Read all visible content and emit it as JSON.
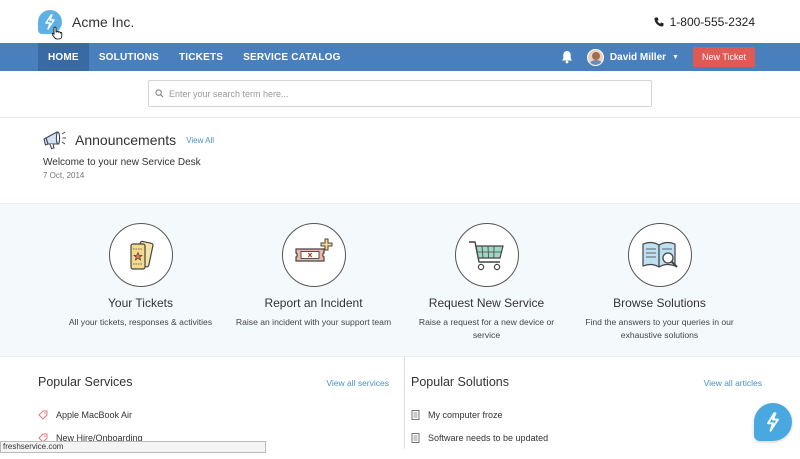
{
  "header": {
    "brand": "Acme Inc.",
    "phone": "1-800-555-2324"
  },
  "nav": {
    "items": [
      "HOME",
      "SOLUTIONS",
      "TICKETS",
      "SERVICE CATALOG"
    ],
    "user_name": "David Miller",
    "new_ticket": "New Ticket"
  },
  "search": {
    "placeholder": "Enter your search term here..."
  },
  "announcements": {
    "title": "Announcements",
    "view_all": "View All",
    "message": "Welcome to your new Service Desk",
    "date": "7 Oct, 2014"
  },
  "features": [
    {
      "title": "Your Tickets",
      "desc": "All your tickets, responses & activities",
      "icon": "tickets-icon"
    },
    {
      "title": "Report an Incident",
      "desc": "Raise an incident with your support team",
      "icon": "incident-icon"
    },
    {
      "title": "Request New Service",
      "desc": "Raise a request for a new device or service",
      "icon": "cart-icon"
    },
    {
      "title": "Browse Solutions",
      "desc": "Find the answers to your queries in our exhaustive solutions",
      "icon": "book-search-icon"
    }
  ],
  "popular_services": {
    "title": "Popular Services",
    "link": "View all services",
    "items": [
      "Apple MacBook Air",
      "New Hire/Onboarding"
    ]
  },
  "popular_solutions": {
    "title": "Popular Solutions",
    "link": "View all articles",
    "items": [
      "My computer froze",
      "Software needs to be updated"
    ]
  },
  "status_bar": "freshservice.com",
  "colors": {
    "nav_bg": "#4a7fbe",
    "nav_active": "#3a6aa3",
    "accent_red": "#e05a55",
    "link_blue": "#4a90c8",
    "logo_blue": "#5fb0e4"
  }
}
